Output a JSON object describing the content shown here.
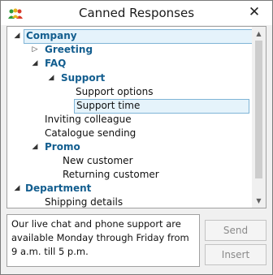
{
  "window": {
    "title": "Canned Responses",
    "close_glyph": "✕",
    "app_icon": "people-group-icon"
  },
  "tree": {
    "company": {
      "label": "Company",
      "toggle": "◢"
    },
    "greeting": {
      "label": "Greeting",
      "toggle": "▷"
    },
    "faq": {
      "label": "FAQ",
      "toggle": "◢"
    },
    "support": {
      "label": "Support",
      "toggle": "◢"
    },
    "support_options": {
      "label": "Support options"
    },
    "support_time": {
      "label": "Support time"
    },
    "inviting_colleague": {
      "label": "Inviting colleague"
    },
    "catalogue_sending": {
      "label": "Catalogue sending"
    },
    "promo": {
      "label": "Promo",
      "toggle": "◢"
    },
    "new_customer": {
      "label": "New customer"
    },
    "returning_customer": {
      "label": "Returning customer"
    },
    "department": {
      "label": "Department",
      "toggle": "◢"
    },
    "shipping_details": {
      "label": "Shipping details"
    }
  },
  "scrollbar": {
    "up_glyph": "▲",
    "down_glyph": "▼"
  },
  "message": {
    "text": "Our live chat and phone support are available Monday through Friday from 9 a.m. till 5 p.m."
  },
  "buttons": {
    "send": "Send",
    "insert": "Insert"
  },
  "colors": {
    "group_text": "#135e8f",
    "selection_bg": "#e5f3fb",
    "selection_border": "#7fb4d6"
  }
}
